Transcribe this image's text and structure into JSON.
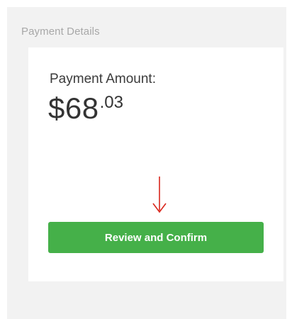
{
  "panel": {
    "title": "Payment Details"
  },
  "payment": {
    "label": "Payment Amount:",
    "amount_currency": "$",
    "amount_whole": "68",
    "amount_cents": ".03"
  },
  "annotation": {
    "icon": "down-arrow-icon",
    "color": "#d9261c"
  },
  "actions": {
    "confirm_label": "Review and Confirm",
    "confirm_color": "#45b049"
  }
}
